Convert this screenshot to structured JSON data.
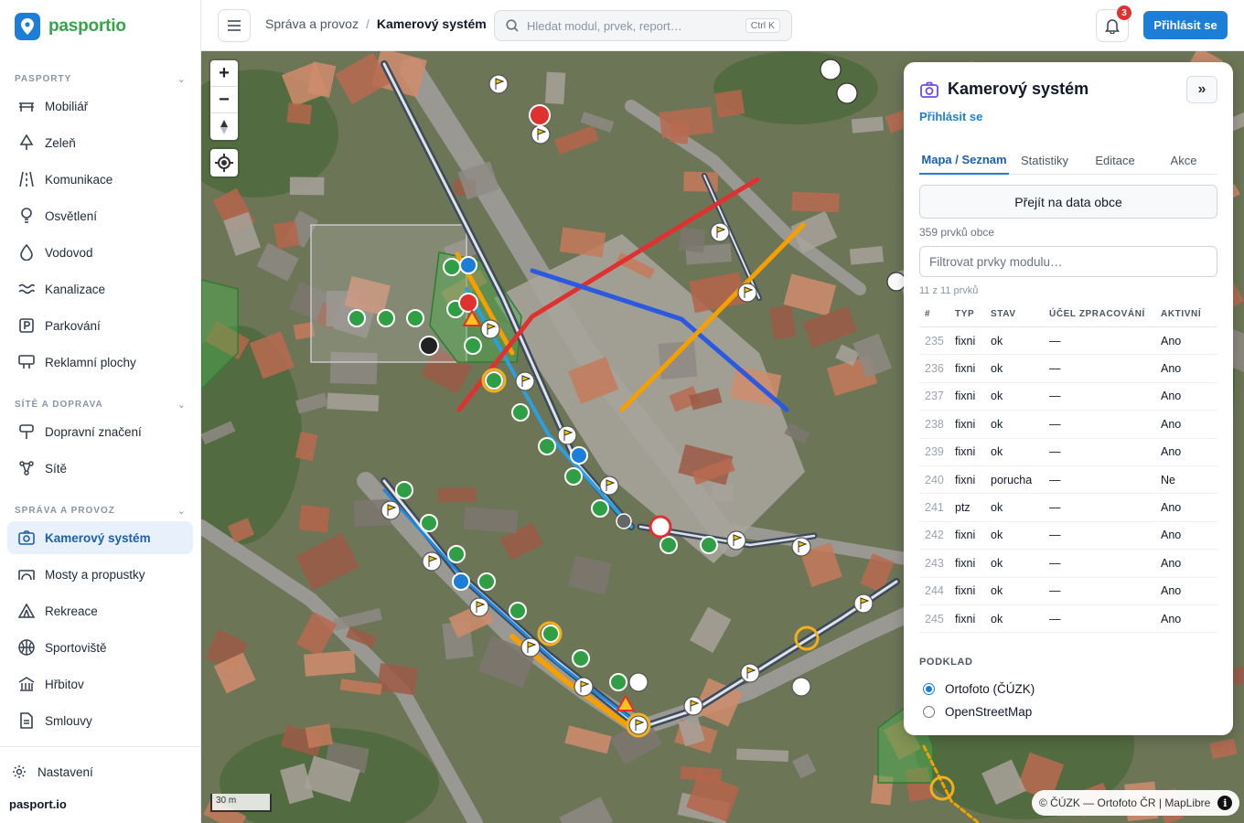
{
  "app": {
    "name": "pasportio",
    "footer_brand": "pasport.io"
  },
  "sidebar": {
    "sections": [
      {
        "title": "PASPORTY",
        "items": [
          "Mobiliář",
          "Zeleň",
          "Komunikace",
          "Osvětlení",
          "Vodovod",
          "Kanalizace",
          "Parkování",
          "Reklamní plochy"
        ]
      },
      {
        "title": "SÍTĚ A DOPRAVA",
        "items": [
          "Dopravní značení",
          "Sítě"
        ]
      },
      {
        "title": "SPRÁVA A PROVOZ",
        "items": [
          "Kamerový systém",
          "Mosty a propustky",
          "Rekreace",
          "Sportoviště",
          "Hřbitov",
          "Smlouvy"
        ]
      }
    ],
    "active_item": "Kamerový systém",
    "settings_label": "Nastavení"
  },
  "header": {
    "breadcrumb": [
      "Správa a provoz",
      "Kamerový systém"
    ],
    "search_placeholder": "Hledat modul, prvek, report…",
    "search_shortcut": "Ctrl K",
    "notifications_count": "3",
    "login_label": "Přihlásit se"
  },
  "map": {
    "scale_label": "30 m",
    "attribution": "© ČÚZK — Ortofoto ČR | MapLibre",
    "zoom_in": "+",
    "zoom_out": "−"
  },
  "panel": {
    "title": "Kamerový systém",
    "login_link": "Přihlásit se",
    "tabs": [
      "Mapa / Seznam",
      "Statistiky",
      "Editace",
      "Akce"
    ],
    "active_tab": "Mapa / Seznam",
    "data_button": "Přejít na data obce",
    "count_text": "359 prvků obce",
    "filter_placeholder": "Filtrovat prvky modulu…",
    "sub_count": "11 z 11 prvků",
    "table": {
      "columns": [
        "#",
        "TYP",
        "STAV",
        "ÚČEL ZPRACOVÁNÍ",
        "AKTIVNÍ"
      ],
      "rows": [
        [
          "235",
          "fixni",
          "ok",
          "—",
          "Ano"
        ],
        [
          "236",
          "fixni",
          "ok",
          "—",
          "Ano"
        ],
        [
          "237",
          "fixni",
          "ok",
          "—",
          "Ano"
        ],
        [
          "238",
          "fixni",
          "ok",
          "—",
          "Ano"
        ],
        [
          "239",
          "fixni",
          "ok",
          "—",
          "Ano"
        ],
        [
          "240",
          "fixni",
          "porucha",
          "—",
          "Ne"
        ],
        [
          "241",
          "ptz",
          "ok",
          "—",
          "Ano"
        ],
        [
          "242",
          "fixni",
          "ok",
          "—",
          "Ano"
        ],
        [
          "243",
          "fixni",
          "ok",
          "—",
          "Ano"
        ],
        [
          "244",
          "fixni",
          "ok",
          "—",
          "Ano"
        ],
        [
          "245",
          "fixni",
          "ok",
          "—",
          "Ano"
        ]
      ]
    },
    "basemap": {
      "title": "PODKLAD",
      "options": [
        "Ortofoto (ČÚZK)",
        "OpenStreetMap"
      ],
      "selected": "Ortofoto (ČÚZK)"
    }
  },
  "colors": {
    "accent": "#1c7ed6",
    "brand_green": "#37a34a",
    "line_red": "#e03131",
    "line_blue": "#2b59e0",
    "line_orange": "#f59f00"
  }
}
